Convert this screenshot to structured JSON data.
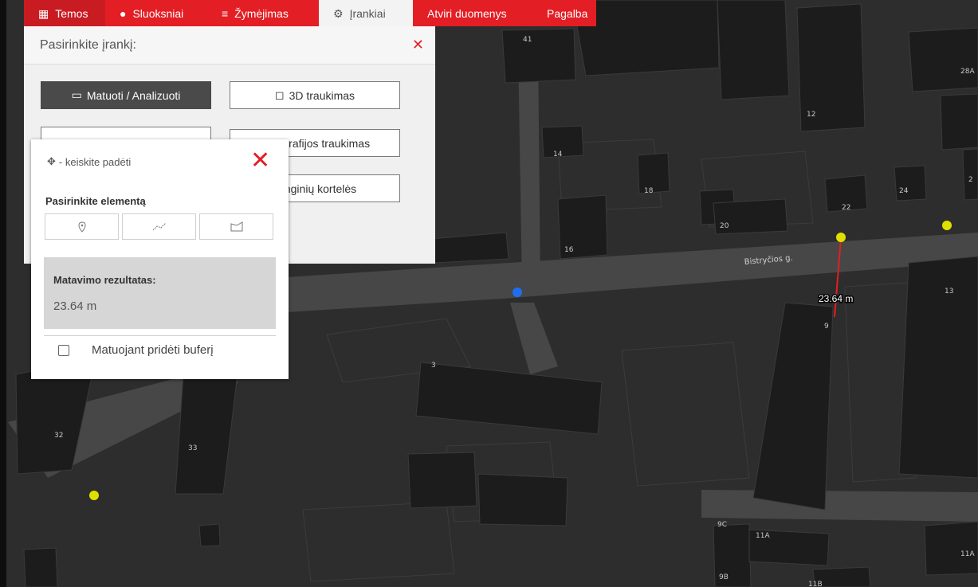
{
  "nav": {
    "tabs": [
      {
        "label": "Temos",
        "icon": "map-icon"
      },
      {
        "label": "Sluoksniai",
        "icon": "layers-icon"
      },
      {
        "label": "Žymėjimas",
        "icon": "list-icon"
      },
      {
        "label": "Įrankiai",
        "icon": "gear-icon",
        "active": true
      },
      {
        "label": "Atviri duomenys"
      },
      {
        "label": "Pagalba"
      }
    ]
  },
  "tools_panel": {
    "title": "Pasirinkite įrankį:",
    "buttons": [
      {
        "label": "Matuoti / Analizuoti",
        "icon": "ruler-icon",
        "active": true
      },
      {
        "label": "3D traukimas",
        "icon": "cube-icon"
      },
      {
        "label": "…grafijos traukimas",
        "icon": "photo-icon"
      },
      {
        "label": "…nginių kortelės"
      }
    ]
  },
  "measure_popup": {
    "move_hint": "- keiskite padėti",
    "select_label": "Pasirinkite elementą",
    "tools": [
      {
        "name": "point",
        "icon": "point-marker-icon"
      },
      {
        "name": "line",
        "icon": "polyline-icon"
      },
      {
        "name": "polygon",
        "icon": "polygon-icon"
      }
    ],
    "result_title": "Matavimo rezultatas:",
    "result_value": "23.64 m",
    "buffer_label": "Matuojant pridėti buferį",
    "buffer_checked": false
  },
  "map": {
    "street_name": "Bistryčios g.",
    "measurement_label": "23.64 m",
    "house_numbers": [
      "41",
      "12",
      "28A",
      "14",
      "18",
      "22",
      "24",
      "2",
      "20",
      "16",
      "13",
      "9",
      "3",
      "32",
      "33",
      "9C",
      "11A",
      "11A",
      "9B",
      "11B"
    ],
    "colors": {
      "accent": "#e31e24",
      "measure_line": "#e02020",
      "point_yellow": "#e0e000",
      "point_blue": "#1e6ff0"
    }
  }
}
